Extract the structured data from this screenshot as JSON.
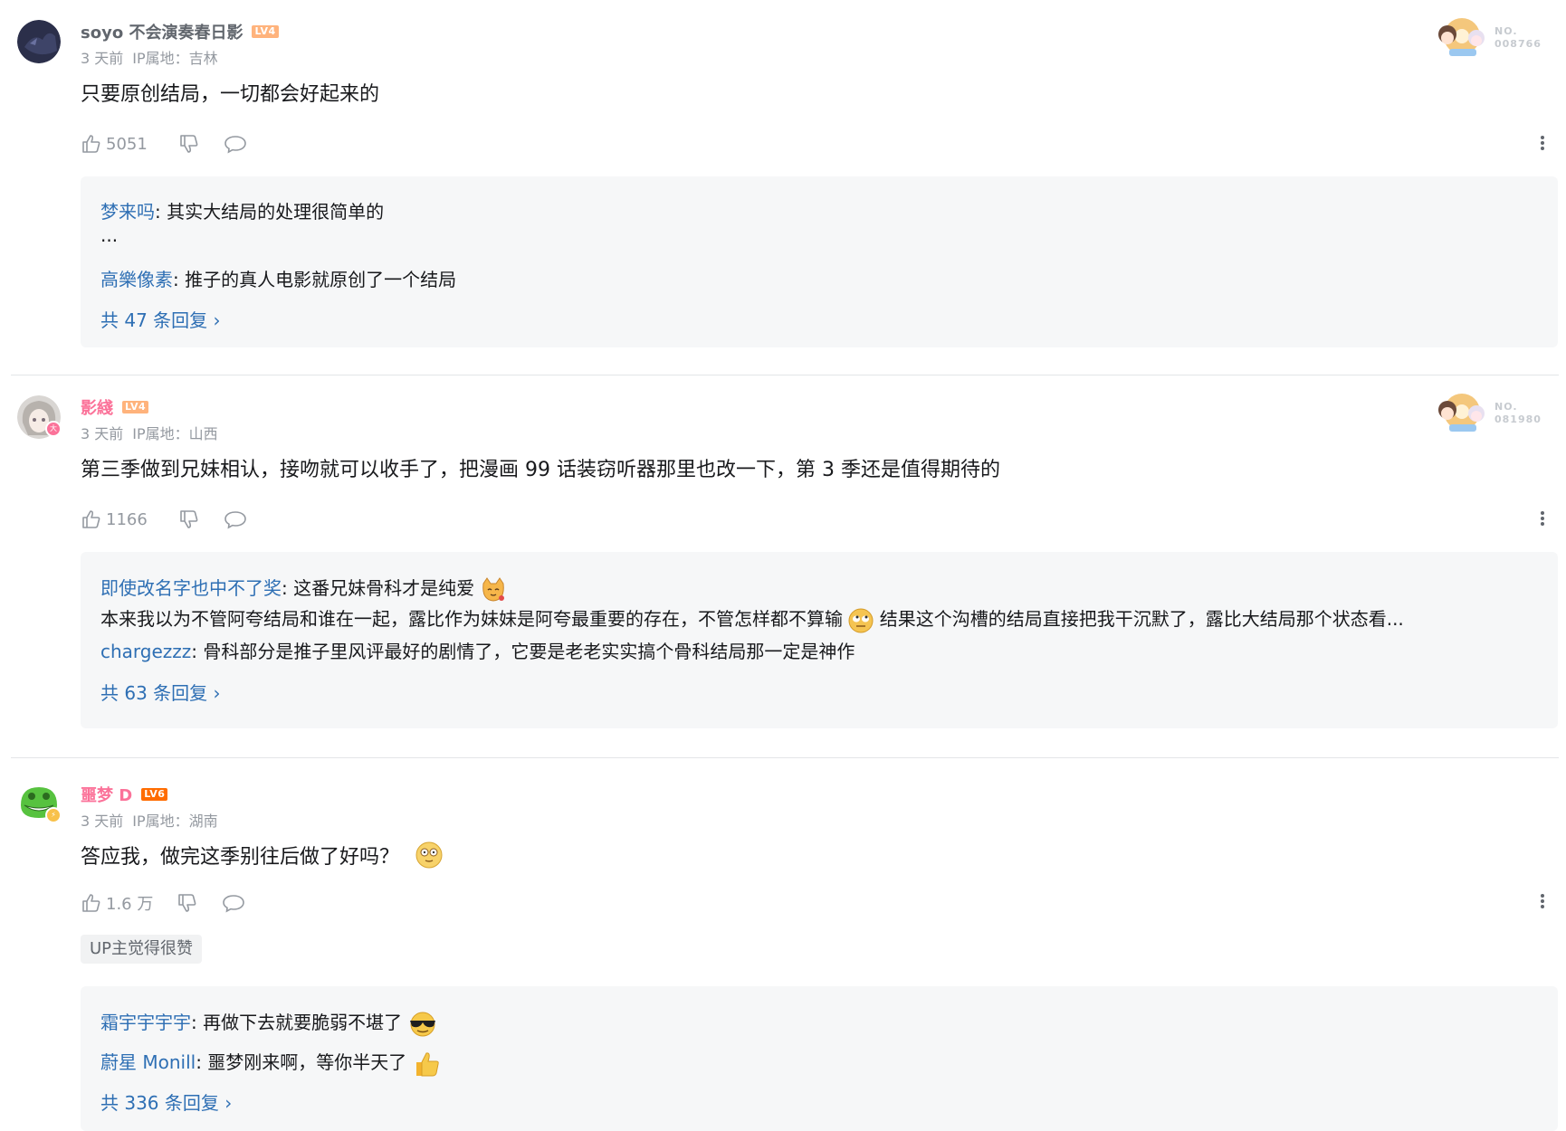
{
  "colors": {
    "link": "#2e6fb4",
    "vip_pink": "#fb7299",
    "lv4": "#ffb37c",
    "lv6": "#ff6c00",
    "muted": "#9499a0",
    "reply_bg": "#f6f7f8"
  },
  "comments": [
    {
      "username": "soyo 不会演奏春日影",
      "level": "LV4",
      "time": "3 天前",
      "ip": "IP属地：吉林",
      "content": "只要原创结局，一切都会好起来的",
      "likes": "5051",
      "fan_no": "NO.\n008766",
      "replies": [
        {
          "name": "梦来吗",
          "text": ": 其实大结局的处理很简单的"
        },
        {
          "name": "",
          "text": "..."
        },
        {
          "name": "高樂像素",
          "text": ": 推子的真人电影就原创了一个结局"
        }
      ],
      "more_replies": "共 47 条回复 ›"
    },
    {
      "username": "影綫",
      "level": "LV4",
      "time": "3 天前",
      "ip": "IP属地：山西",
      "content": "第三季做到兄妹相认，接吻就可以收手了，把漫画 99 话装窃听器那里也改一下，第 3 季还是值得期待的",
      "likes": "1166",
      "fan_no": "NO.\n081980",
      "replies": [
        {
          "name": "即使改名字也中不了奖",
          "text": ": 这番兄妹骨科才是纯爱"
        },
        {
          "name": "",
          "text": "本来我以为不管阿夸结局和谁在一起，露比作为妹妹是阿夸最重要的存在，不管怎样都不算输",
          "text2": "结果这个沟槽的结局直接把我干沉默了，露比大结局那个状态看..."
        },
        {
          "name": "chargezzz",
          "text": ": 骨科部分是推子里风评最好的剧情了，它要是老老实实搞个骨科结局那一定是神作"
        }
      ],
      "more_replies": "共 63 条回复 ›"
    },
    {
      "username": "噩梦 D",
      "level": "LV6",
      "time": "3 天前",
      "ip": "IP属地：湖南",
      "content": "答应我，做完这季别往后做了好吗？",
      "likes": "1.6 万",
      "up_tag": "UP主觉得很赞",
      "replies": [
        {
          "name": "霜宇宇宇宇",
          "text": ": 再做下去就要脆弱不堪了"
        },
        {
          "name": "蔚星 Monill",
          "text": ": 噩梦刚来啊，等你半天了"
        }
      ],
      "more_replies": "共 336 条回复 ›"
    }
  ]
}
